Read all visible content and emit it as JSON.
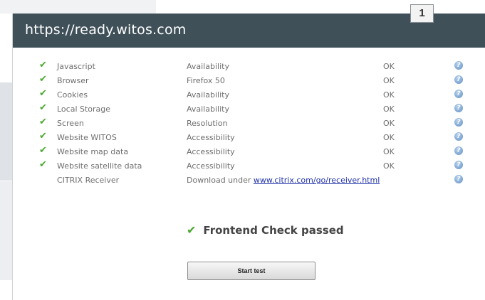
{
  "window": {
    "url": "https://ready.witos.com",
    "badge": "1"
  },
  "checks": [
    {
      "name": "Javascript",
      "test": "Availability",
      "status": "OK",
      "icon": "check-icon"
    },
    {
      "name": "Browser",
      "test": "Firefox 50",
      "status": "OK",
      "icon": "check-icon"
    },
    {
      "name": "Cookies",
      "test": "Availability",
      "status": "OK",
      "icon": "check-icon"
    },
    {
      "name": "Local Storage",
      "test": "Availability",
      "status": "OK",
      "icon": "check-icon"
    },
    {
      "name": "Screen",
      "test": "Resolution",
      "status": "OK",
      "icon": "check-icon"
    },
    {
      "name": "Website WITOS",
      "test": "Accessibility",
      "status": "OK",
      "icon": "check-icon"
    },
    {
      "name": "Website map data",
      "test": "Accessibility",
      "status": "OK",
      "icon": "check-icon"
    },
    {
      "name": "Website satellite data",
      "test": "Accessibility",
      "status": "OK",
      "icon": "check-icon"
    }
  ],
  "citrix": {
    "name": "CITRIX Receiver",
    "text": "Download under",
    "link": "www.citrix.com/go/receiver.html"
  },
  "result": {
    "text": "Frontend Check passed"
  },
  "start_button": "Start test",
  "colors": {
    "titlebar": "#3f5059",
    "check": "#4aa830",
    "link": "#2233aa"
  }
}
